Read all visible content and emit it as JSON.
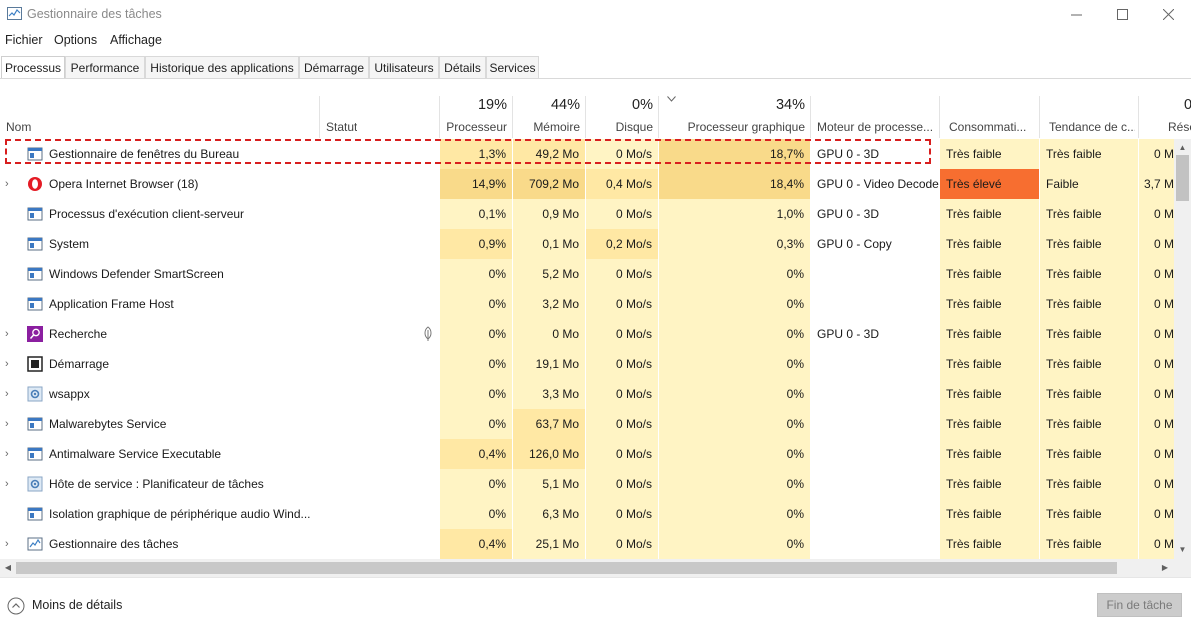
{
  "window": {
    "title": "Gestionnaire des tâches",
    "controls": {
      "minimize": "—",
      "maximize": "☐",
      "close": "✕"
    }
  },
  "menu": [
    "Fichier",
    "Options",
    "Affichage"
  ],
  "tabs": [
    {
      "label": "Processus",
      "active": true
    },
    {
      "label": "Performance",
      "active": false
    },
    {
      "label": "Historique des applications",
      "active": false
    },
    {
      "label": "Démarrage",
      "active": false
    },
    {
      "label": "Utilisateurs",
      "active": false
    },
    {
      "label": "Détails",
      "active": false
    },
    {
      "label": "Services",
      "active": false
    }
  ],
  "columns": {
    "name": {
      "label": "Nom"
    },
    "status": {
      "label": "Statut"
    },
    "cpu": {
      "label": "Processeur",
      "pct": "19%"
    },
    "mem": {
      "label": "Mémoire",
      "pct": "44%"
    },
    "disk": {
      "label": "Disque",
      "pct": "0%"
    },
    "gpu": {
      "label": "Processeur graphique",
      "pct": "34%"
    },
    "engine": {
      "label": "Moteur de processe..."
    },
    "power": {
      "label": "Consommati..."
    },
    "trend": {
      "label": "Tendance de c..."
    },
    "net": {
      "label": "Rése",
      "pct": "0"
    }
  },
  "processes": [
    {
      "name": "Gestionnaire de fenêtres du Bureau",
      "icon": "window-app-icon",
      "expandable": false,
      "status_leaf": false,
      "cpu": "1,3%",
      "mem": "49,2 Mo",
      "disk": "0 Mo/s",
      "gpu": "18,7%",
      "engine": "GPU 0 - 3D",
      "power": "Très faible",
      "trend": "Très faible",
      "net": "0 M"
    },
    {
      "name": "Opera Internet Browser (18)",
      "icon": "opera-icon",
      "expandable": true,
      "status_leaf": false,
      "cpu": "14,9%",
      "mem": "709,2 Mo",
      "disk": "0,4 Mo/s",
      "gpu": "18,4%",
      "engine": "GPU 0 - Video Decode",
      "power": "Très élevé",
      "trend": "Faible",
      "net": "3,7 M"
    },
    {
      "name": "Processus d'exécution client-serveur",
      "icon": "window-app-icon",
      "expandable": false,
      "status_leaf": false,
      "cpu": "0,1%",
      "mem": "0,9 Mo",
      "disk": "0 Mo/s",
      "gpu": "1,0%",
      "engine": "GPU 0 - 3D",
      "power": "Très faible",
      "trend": "Très faible",
      "net": "0 M"
    },
    {
      "name": "System",
      "icon": "window-app-icon",
      "expandable": false,
      "status_leaf": false,
      "cpu": "0,9%",
      "mem": "0,1 Mo",
      "disk": "0,2 Mo/s",
      "gpu": "0,3%",
      "engine": "GPU 0 - Copy",
      "power": "Très faible",
      "trend": "Très faible",
      "net": "0 M"
    },
    {
      "name": "Windows Defender SmartScreen",
      "icon": "window-app-icon",
      "expandable": false,
      "status_leaf": false,
      "cpu": "0%",
      "mem": "5,2 Mo",
      "disk": "0 Mo/s",
      "gpu": "0%",
      "engine": "",
      "power": "Très faible",
      "trend": "Très faible",
      "net": "0 M"
    },
    {
      "name": "Application Frame Host",
      "icon": "window-app-icon",
      "expandable": false,
      "status_leaf": false,
      "cpu": "0%",
      "mem": "3,2 Mo",
      "disk": "0 Mo/s",
      "gpu": "0%",
      "engine": "",
      "power": "Très faible",
      "trend": "Très faible",
      "net": "0 M"
    },
    {
      "name": "Recherche",
      "icon": "search-app-icon",
      "expandable": true,
      "status_leaf": true,
      "cpu": "0%",
      "mem": "0 Mo",
      "disk": "0 Mo/s",
      "gpu": "0%",
      "engine": "GPU 0 - 3D",
      "power": "Très faible",
      "trend": "Très faible",
      "net": "0 M"
    },
    {
      "name": "Démarrage",
      "icon": "start-app-icon",
      "expandable": true,
      "status_leaf": false,
      "cpu": "0%",
      "mem": "19,1 Mo",
      "disk": "0 Mo/s",
      "gpu": "0%",
      "engine": "",
      "power": "Très faible",
      "trend": "Très faible",
      "net": "0 M"
    },
    {
      "name": "wsappx",
      "icon": "gear-app-icon",
      "expandable": true,
      "status_leaf": false,
      "cpu": "0%",
      "mem": "3,3 Mo",
      "disk": "0 Mo/s",
      "gpu": "0%",
      "engine": "",
      "power": "Très faible",
      "trend": "Très faible",
      "net": "0 M"
    },
    {
      "name": "Malwarebytes Service",
      "icon": "window-app-icon",
      "expandable": true,
      "status_leaf": false,
      "cpu": "0%",
      "mem": "63,7 Mo",
      "disk": "0 Mo/s",
      "gpu": "0%",
      "engine": "",
      "power": "Très faible",
      "trend": "Très faible",
      "net": "0 M"
    },
    {
      "name": "Antimalware Service Executable",
      "icon": "window-app-icon",
      "expandable": true,
      "status_leaf": false,
      "cpu": "0,4%",
      "mem": "126,0 Mo",
      "disk": "0 Mo/s",
      "gpu": "0%",
      "engine": "",
      "power": "Très faible",
      "trend": "Très faible",
      "net": "0 M"
    },
    {
      "name": "Hôte de service : Planificateur de tâches",
      "icon": "gear-app-icon",
      "expandable": true,
      "status_leaf": false,
      "cpu": "0%",
      "mem": "5,1 Mo",
      "disk": "0 Mo/s",
      "gpu": "0%",
      "engine": "",
      "power": "Très faible",
      "trend": "Très faible",
      "net": "0 M"
    },
    {
      "name": "Isolation graphique de périphérique audio Wind...",
      "icon": "window-app-icon",
      "expandable": false,
      "status_leaf": false,
      "cpu": "0%",
      "mem": "6,3 Mo",
      "disk": "0 Mo/s",
      "gpu": "0%",
      "engine": "",
      "power": "Très faible",
      "trend": "Très faible",
      "net": "0 M"
    },
    {
      "name": "Gestionnaire des tâches",
      "icon": "taskmgr-app-icon",
      "expandable": true,
      "status_leaf": false,
      "cpu": "0,4%",
      "mem": "25,1 Mo",
      "disk": "0 Mo/s",
      "gpu": "0%",
      "engine": "",
      "power": "Très faible",
      "trend": "Très faible",
      "net": "0 M"
    }
  ],
  "footer": {
    "less_details": "Moins de détails",
    "end_task": "Fin de tâche"
  },
  "colors": {
    "heat_light": "#fff4c4",
    "heat_mid": "#ffe8a4",
    "heat_strong": "#f9da8a",
    "power_very_high": "#f76e30",
    "highlight_border": "#d81e1e"
  }
}
